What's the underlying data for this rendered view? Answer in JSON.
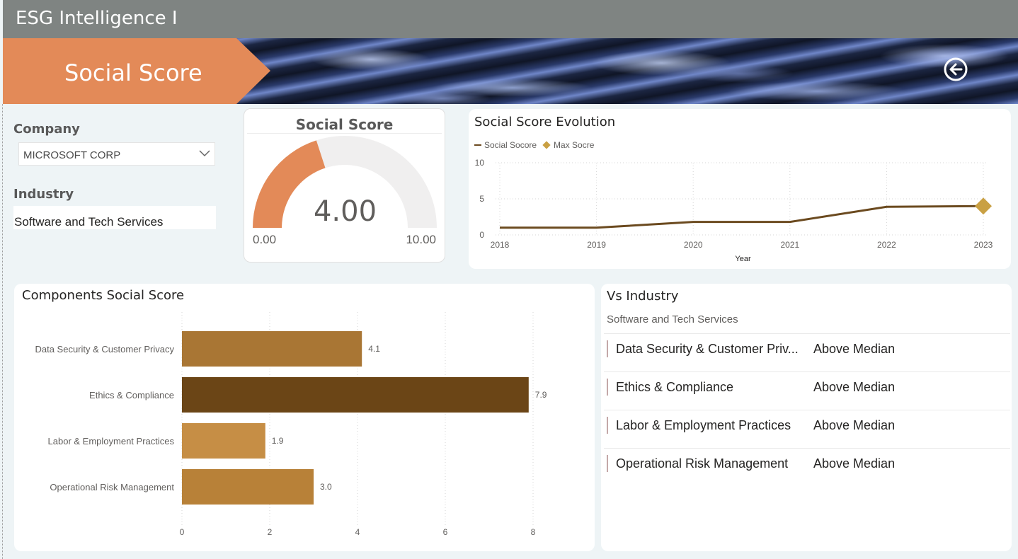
{
  "app": {
    "title": "ESG Intelligence I"
  },
  "banner": {
    "section_title": "Social Score",
    "back_icon": "back-arrow-circle-icon"
  },
  "filters": {
    "company_label": "Company",
    "company_value": "MICROSOFT CORP",
    "industry_label": "Industry",
    "industry_value": "Software and Tech Services"
  },
  "gauge": {
    "title": "Social Score",
    "value": 4.0,
    "value_text": "4.00",
    "min_text": "0.00",
    "max_text": "10.00",
    "min": 0,
    "max": 10,
    "fill_color": "#e38a58",
    "track_color": "#f0efef"
  },
  "evolution": {
    "title": "Social Score Evolution",
    "legend": {
      "series1": "Social Socore",
      "series2": "Max Socre"
    },
    "xlabel": "Year"
  },
  "components": {
    "title": "Components Social Score"
  },
  "vs_industry": {
    "title": "Vs Industry",
    "subtitle": "Software and Tech Services",
    "rows": [
      {
        "name": "Data Security & Customer Priv...",
        "status": "Above Median"
      },
      {
        "name": "Ethics & Compliance",
        "status": "Above Median"
      },
      {
        "name": "Labor & Employment Practices",
        "status": "Above Median"
      },
      {
        "name": "Operational Risk Management",
        "status": "Above Median"
      }
    ]
  },
  "chart_data": [
    {
      "type": "line",
      "title": "Social Score Evolution",
      "xlabel": "Year",
      "ylabel": "",
      "x": [
        "2018",
        "2019",
        "2020",
        "2021",
        "2022",
        "2023"
      ],
      "series": [
        {
          "name": "Social Socore",
          "values": [
            1.0,
            1.0,
            1.8,
            1.8,
            3.9,
            4.0
          ],
          "color": "#6b4a1f"
        },
        {
          "name": "Max Socre",
          "values": [
            null,
            null,
            null,
            null,
            null,
            4.0
          ],
          "color": "#c9a043",
          "marker": "diamond"
        }
      ],
      "yticks": [
        0,
        5,
        10
      ],
      "ylim": [
        0,
        10
      ],
      "grid": true,
      "legend_position": "top-left"
    },
    {
      "type": "bar",
      "orientation": "horizontal",
      "title": "Components Social Score",
      "categories": [
        "Data Security & Customer Privacy",
        "Ethics & Compliance",
        "Labor & Employment Practices",
        "Operational Risk Management"
      ],
      "values": [
        4.1,
        7.9,
        1.9,
        3.0
      ],
      "labels": [
        "4.1",
        "7.9",
        "1.9",
        "3.0"
      ],
      "colors": [
        "#a97634",
        "#6b4516",
        "#c68e45",
        "#b88138"
      ],
      "xticks": [
        0,
        2,
        4,
        6,
        8
      ],
      "xlim": [
        0,
        8.5
      ],
      "grid": true
    }
  ]
}
